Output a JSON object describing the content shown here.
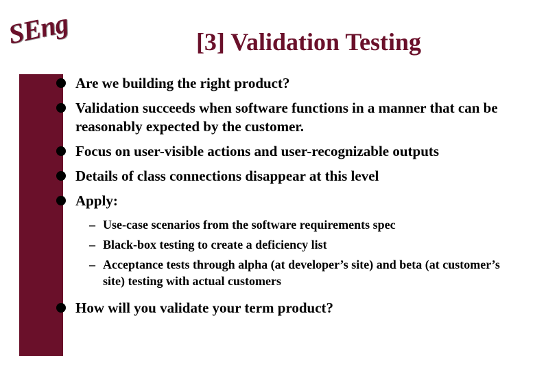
{
  "logo_text": "SEng",
  "title": "[3] Validation Testing",
  "bullets": {
    "b0": "Are we building the right product?",
    "b1": "Validation succeeds when software functions in a manner that can be reasonably expected by the customer.",
    "b2": "Focus on user-visible actions and user-recognizable outputs",
    "b3": "Details of class connections disappear at this level",
    "b4": "Apply:",
    "b5": "How will you validate your term product?"
  },
  "subs": {
    "s0": "Use-case scenarios from the software requirements spec",
    "s1": "Black-box testing to create a deficiency list",
    "s2": "Acceptance tests through alpha (at developer’s site) and beta (at customer’s site) testing with actual customers"
  }
}
